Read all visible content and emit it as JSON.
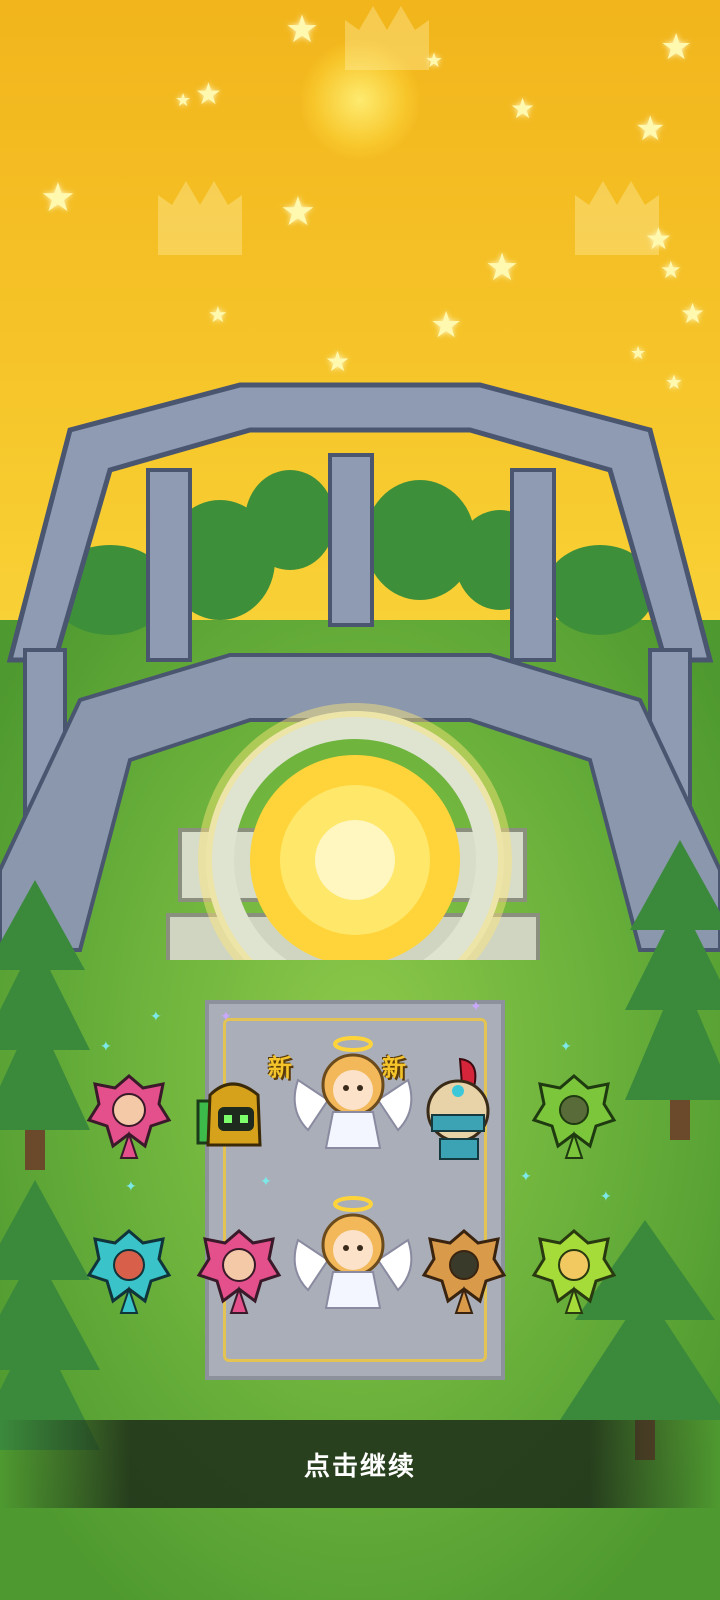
{
  "labels": {
    "new_badge_left": "新",
    "new_badge_right": "新",
    "continue_prompt": "点击继续"
  },
  "colors": {
    "sky": "#f6c62a",
    "grass": "#6cb23c",
    "stone": "#8e9bb3",
    "portal": "#ffd43a",
    "new_badge": "#f4c42a"
  },
  "icons": {
    "portal": "sun-portal",
    "decor": [
      "star",
      "crown",
      "pine-tree"
    ]
  },
  "characters": [
    {
      "name": "pink-flower-hero",
      "row": 1
    },
    {
      "name": "gold-robot-hero",
      "row": 1
    },
    {
      "name": "angel-hero",
      "row": 1
    },
    {
      "name": "feather-helmet-hero",
      "row": 1
    },
    {
      "name": "green-flower-hero",
      "row": 1
    },
    {
      "name": "cyan-flower-hero",
      "row": 2
    },
    {
      "name": "pink-flower-hero-2",
      "row": 2
    },
    {
      "name": "angel-hero-2",
      "row": 2
    },
    {
      "name": "orange-flower-hero",
      "row": 2
    },
    {
      "name": "lime-flower-hero",
      "row": 2
    }
  ]
}
